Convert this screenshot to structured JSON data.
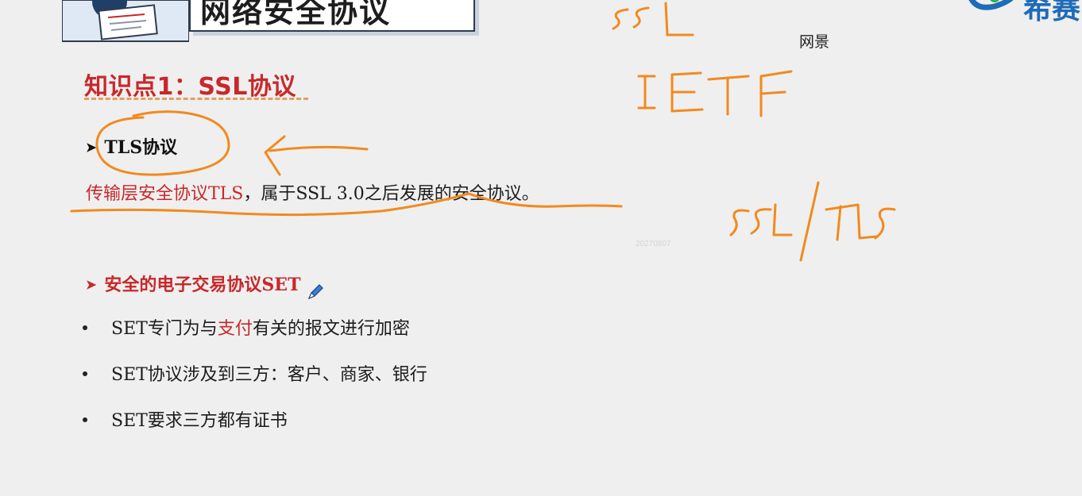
{
  "header": {
    "title": "网络安全协议"
  },
  "logo": {
    "text": "希赛"
  },
  "section": {
    "heading": "知识点1：SSL协议"
  },
  "tls": {
    "heading": "TLS协议",
    "definition_term": "传输层安全协议TLS",
    "definition_rest": "，属于SSL 3.0之后发展的安全协议。"
  },
  "watermark": "20270807",
  "set": {
    "heading": "安全的电子交易协议SET",
    "bullets": [
      {
        "before": "SET专门为与",
        "highlight": "支付",
        "after": "有关的报文进行加密"
      },
      {
        "before": "SET协议涉及到三方：客户、商家、银行",
        "highlight": "",
        "after": ""
      },
      {
        "before": "SET要求三方都有证书",
        "highlight": "",
        "after": ""
      }
    ]
  },
  "side_note": "网景",
  "annotations": {
    "color": "#f28a1e",
    "handwritten": [
      "SSL",
      "IETF",
      "SSL/TLS"
    ]
  },
  "colors": {
    "accent_red": "#c8282a",
    "background": "#efefef",
    "logo_blue": "#1e6bb8"
  },
  "icons": {
    "header_illustration": "reading-person-icon",
    "cursor": "pen-cursor-icon",
    "bullet_arrow": "arrow-bullet-icon"
  }
}
